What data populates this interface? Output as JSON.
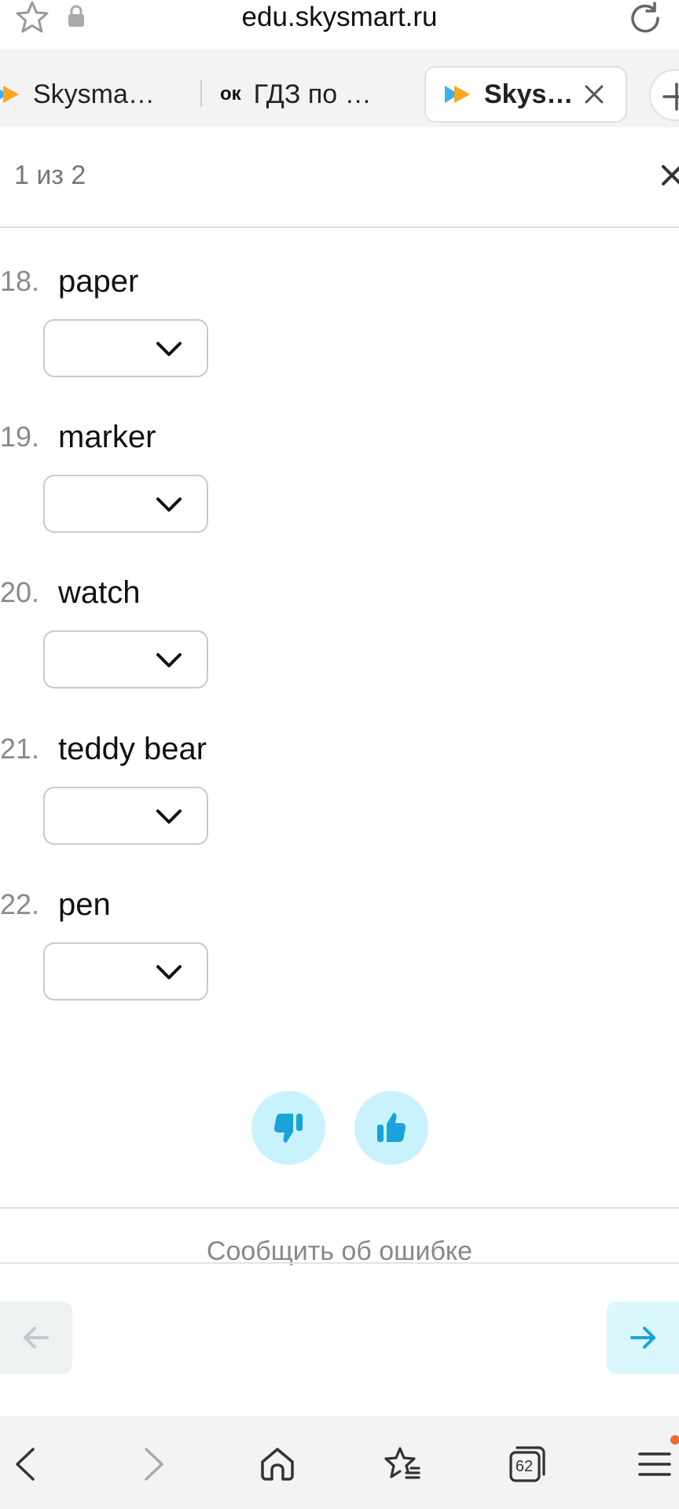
{
  "browser": {
    "url": "edu.skysmart.ru",
    "tabs": [
      {
        "title": "Skysma…",
        "icon": "skysmart-logo-icon"
      },
      {
        "title": "ГДЗ по …",
        "icon_text": "ок"
      },
      {
        "title": "Skys…",
        "icon": "skysmart-logo-icon",
        "active": true
      }
    ],
    "bottom_bar": {
      "tab_count": "62"
    }
  },
  "task": {
    "counter": "1 из 2",
    "items": [
      {
        "number": "18.",
        "word": "paper"
      },
      {
        "number": "19.",
        "word": "marker"
      },
      {
        "number": "20.",
        "word": "watch"
      },
      {
        "number": "21.",
        "word": "teddy bear"
      },
      {
        "number": "22.",
        "word": "pen"
      }
    ],
    "report_error": "Сообщить об ошибке"
  },
  "colors": {
    "accent": "#1aa3d9",
    "rating_bg": "#c8f3fc",
    "next_bg": "#d9f7fd",
    "prev_bg": "#eef1f2",
    "notification_dot": "#f26a2b"
  }
}
